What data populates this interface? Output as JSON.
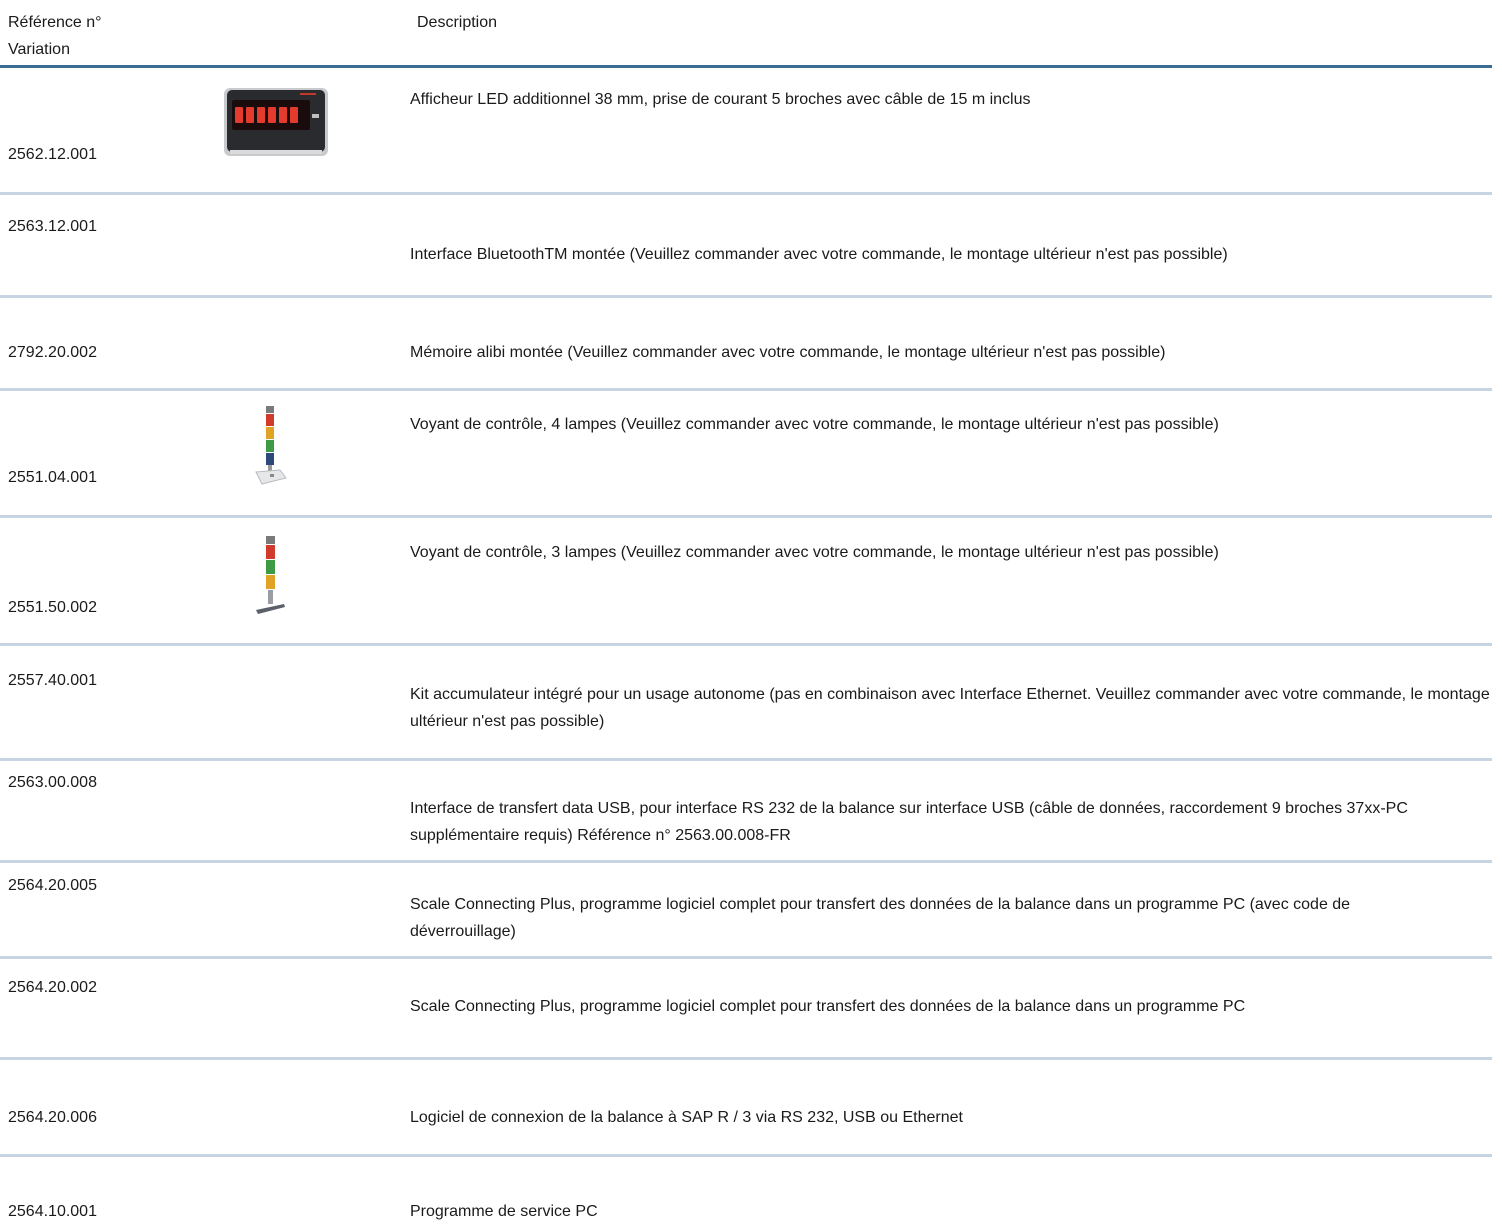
{
  "header": {
    "ref_label": "Référence n°",
    "variation_label": "Variation",
    "description_label": "Description"
  },
  "rows": [
    {
      "ref": "2562.12.001",
      "description": "Afficheur LED additionnel 38 mm, prise de courant 5 broches avec câble de 15 m inclus",
      "image": "led-display-icon"
    },
    {
      "ref": "2563.12.001",
      "description": "Interface BluetoothTM montée (Veuillez commander avec votre commande, le montage ultérieur n'est pas possible)"
    },
    {
      "ref": "2792.20.002",
      "description": "Mémoire alibi montée (Veuillez commander avec votre commande, le montage ultérieur n'est pas possible)"
    },
    {
      "ref": "2551.04.001",
      "description": "Voyant de contrôle, 4 lampes (Veuillez commander avec votre commande, le montage ultérieur n'est pas possible)",
      "image": "signal-light-4-icon"
    },
    {
      "ref": "2551.50.002",
      "description": "Voyant de contrôle, 3 lampes (Veuillez commander avec votre commande, le montage ultérieur n'est pas possible)",
      "image": "signal-light-3-icon"
    },
    {
      "ref": "2557.40.001",
      "description": "Kit accumulateur intégré pour un usage autonome (pas en combinaison avec Interface Ethernet. Veuillez commander avec votre commande, le montage ultérieur n'est pas possible)"
    },
    {
      "ref": "2563.00.008",
      "description": "Interface de transfert data USB, pour interface RS 232 de la balance sur interface USB (câble de données, raccordement 9 broches 37xx-PC supplémentaire requis) Référence n° 2563.00.008-FR"
    },
    {
      "ref": "2564.20.005",
      "description": "Scale Connecting Plus, programme logiciel complet pour transfert des données de la balance dans un programme PC (avec code de déverrouillage)"
    },
    {
      "ref": "2564.20.002",
      "description": "Scale Connecting Plus, programme logiciel complet pour transfert des données de la balance dans un programme PC"
    },
    {
      "ref": "2564.20.006",
      "description": "Logiciel de connexion de la balance à SAP R / 3 via RS 232, USB ou Ethernet"
    },
    {
      "ref": "2564.10.001",
      "description": "Programme de service PC"
    }
  ]
}
